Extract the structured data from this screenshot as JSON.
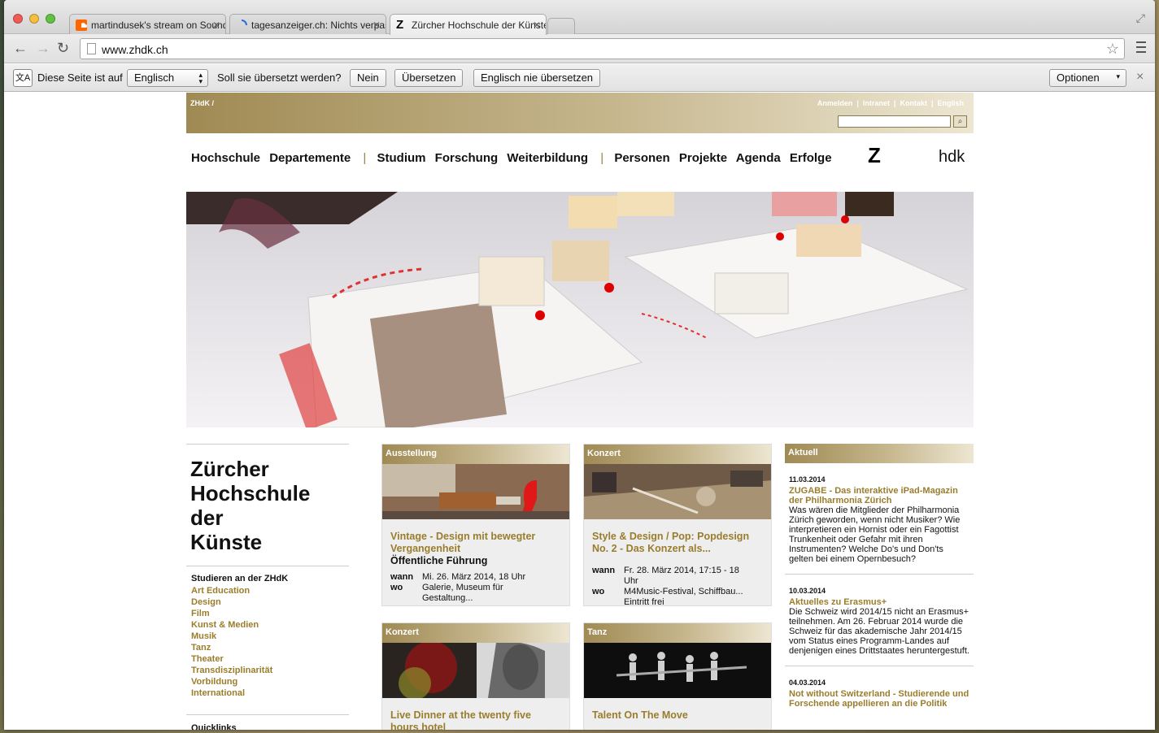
{
  "browser": {
    "tabs": [
      {
        "title": "martindusek's stream on SoundCloud",
        "icon": "soundcloud-icon"
      },
      {
        "title": "tagesanzeiger.ch: Nichts verpassen",
        "icon": "loading-spinner-icon"
      },
      {
        "title": "Zürcher Hochschule der Künste",
        "icon": "zhdk-icon"
      }
    ],
    "url": "www.zhdk.ch"
  },
  "translate_bar": {
    "prefix": "Diese Seite ist auf",
    "language": "Englisch",
    "question": "Soll sie übersetzt werden?",
    "no": "Nein",
    "translate": "Übersetzen",
    "never": "Englisch nie übersetzen",
    "options": "Optionen",
    "close": "×"
  },
  "header": {
    "breadcrumb": "ZHdK /",
    "links": [
      "Anmelden",
      "Intranet",
      "Kontakt",
      "English"
    ],
    "search_icon": "magnifier-icon"
  },
  "nav": {
    "group1": [
      "Hochschule",
      "Departemente"
    ],
    "group2": [
      "Studium",
      "Forschung",
      "Weiterbildung"
    ],
    "group3": [
      "Personen",
      "Projekte",
      "Agenda",
      "Erfolge"
    ],
    "separator": "|"
  },
  "logo": {
    "z": "Z",
    "text": "hdk"
  },
  "sidebar": {
    "title_lines": [
      "Zürcher",
      "Hochschule",
      "der",
      "Künste"
    ],
    "heading": "Studieren an der ZHdK",
    "links": [
      "Art Education",
      "Design",
      "Film",
      "Kunst & Medien",
      "Musik",
      "Tanz",
      "Theater",
      "Transdisziplinarität",
      "Vorbildung",
      "International"
    ],
    "quicklinks": "Quicklinks"
  },
  "cards": [
    {
      "category": "Ausstellung",
      "title": "Vintage - Design mit bewegter Vergangenheit",
      "subtitle": "Öffentliche Führung",
      "wann_label": "wann",
      "wann": "Mi. 26. März 2014, 18 Uhr",
      "wo_label": "wo",
      "wo": "Galerie, Museum für Gestaltung..."
    },
    {
      "category": "Konzert",
      "title": "Style & Design / Pop: Popdesign No. 2 - Das Konzert als...",
      "subtitle": "",
      "wann_label": "wann",
      "wann": "Fr. 28. März 2014, 17:15 - 18 Uhr",
      "wo_label": "wo",
      "wo": "M4Music-Festival, Schiffbau... Eintritt frei"
    },
    {
      "category": "Konzert",
      "title": "Live Dinner at the twenty five hours hotel"
    },
    {
      "category": "Tanz",
      "title": "Talent On The Move"
    }
  ],
  "aktuell": {
    "heading": "Aktuell",
    "items": [
      {
        "date": "11.03.2014",
        "title": "ZUGABE - Das interaktive iPad-Magazin der Philharmonia Zürich",
        "body": "Was wären die Mitglieder der Philharmonia Zürich geworden, wenn nicht Musiker? Wie interpretieren ein Hornist oder ein Fagottist Trunkenheit oder Gefahr mit ihren Instrumenten? Welche Do's und Don'ts gelten bei einem Opernbesuch?"
      },
      {
        "date": "10.03.2014",
        "title": "Aktuelles zu Erasmus+",
        "body": "Die Schweiz wird 2014/15 nicht an Erasmus+ teilnehmen. Am 26. Februar 2014 wurde die Schweiz für das akademische Jahr 2014/15 vom Status eines Programm-Landes auf denjenigen eines Drittstaates heruntergestuft."
      },
      {
        "date": "04.03.2014",
        "title": "Not without Switzerland - Studierende und Forschende appellieren an die Politik",
        "body": ""
      }
    ]
  },
  "colors": {
    "accent": "#9a7d2c",
    "gold_dark": "#a08a54",
    "gold_light": "#ede6d2"
  }
}
